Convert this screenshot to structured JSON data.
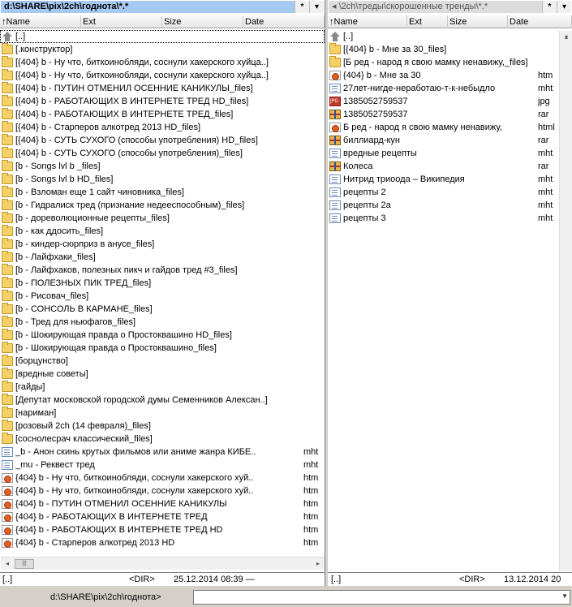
{
  "left": {
    "path": "d:\\SHARE\\pix\\2ch\\годнота\\*.*",
    "star": "*",
    "drop": "▾",
    "cols": {
      "name": "↑Name",
      "ext": "Ext",
      "size": "Size",
      "date": "Date"
    },
    "rows": [
      {
        "icon": "up",
        "name": "[..]",
        "ext": "",
        "selected": true
      },
      {
        "icon": "folder",
        "name": "[.конструктор]",
        "ext": ""
      },
      {
        "icon": "folder",
        "name": "[{404}  b - Ну что, биткоинобляди, соснули хакерского хуйца..]",
        "ext": ""
      },
      {
        "icon": "folder",
        "name": "[{404}  b - Ну что, биткоинобляди, соснули хакерского хуйца..]",
        "ext": ""
      },
      {
        "icon": "folder",
        "name": "[{404}  b - ПУТИН ОТМЕНИЛ ОСЕННИЕ КАНИКУЛЫ_files]",
        "ext": ""
      },
      {
        "icon": "folder",
        "name": "[{404}  b - РАБОТАЮЩИХ В ИНТЕРНЕТЕ ТРЕД HD_files]",
        "ext": ""
      },
      {
        "icon": "folder",
        "name": "[{404}  b - РАБОТАЮЩИХ В ИНТЕРНЕТЕ ТРЕД_files]",
        "ext": ""
      },
      {
        "icon": "folder",
        "name": "[{404}  b - Старперов алкотред 2013 HD_files]",
        "ext": ""
      },
      {
        "icon": "folder",
        "name": "[{404}  b - СУТЬ СУХОГО (способы употребления) HD_files]",
        "ext": ""
      },
      {
        "icon": "folder",
        "name": "[{404}  b - СУТЬ СУХОГО (способы употребления)_files]",
        "ext": ""
      },
      {
        "icon": "folder",
        "name": "[b - Songs lvl  b _files]",
        "ext": ""
      },
      {
        "icon": "folder",
        "name": "[b - Songs lvl  b HD_files]",
        "ext": ""
      },
      {
        "icon": "folder",
        "name": "[b - Взломан еще 1 сайт чиновника_files]",
        "ext": ""
      },
      {
        "icon": "folder",
        "name": "[b - Гидралиск тред (признание недееспособным)_files]",
        "ext": ""
      },
      {
        "icon": "folder",
        "name": "[b - дореволюционные рецепты_files]",
        "ext": ""
      },
      {
        "icon": "folder",
        "name": "[b - как ддосить_files]",
        "ext": ""
      },
      {
        "icon": "folder",
        "name": "[b - киндер-сюрприз в анусе_files]",
        "ext": ""
      },
      {
        "icon": "folder",
        "name": "[b - Лайфхаки_files]",
        "ext": ""
      },
      {
        "icon": "folder",
        "name": "[b - Лайфхаков, полезных пикч и гайдов тред #3_files]",
        "ext": ""
      },
      {
        "icon": "folder",
        "name": "[b - ПОЛЕЗНЫХ ПИК ТРЕД_files]",
        "ext": ""
      },
      {
        "icon": "folder",
        "name": "[b - Рисовач_files]",
        "ext": ""
      },
      {
        "icon": "folder",
        "name": "[b - СОНСОЛЬ В КАРМАНЕ_files]",
        "ext": ""
      },
      {
        "icon": "folder",
        "name": "[b - Тред для ньюфагов_files]",
        "ext": ""
      },
      {
        "icon": "folder",
        "name": "[b - Шокирующая правда о Простоквашино HD_files]",
        "ext": ""
      },
      {
        "icon": "folder",
        "name": "[b - Шокирующая правда о Простоквашино_files]",
        "ext": ""
      },
      {
        "icon": "folder",
        "name": "[борцунство]",
        "ext": ""
      },
      {
        "icon": "folder",
        "name": "[вредные советы]",
        "ext": ""
      },
      {
        "icon": "folder",
        "name": "[гайды]",
        "ext": ""
      },
      {
        "icon": "folder",
        "name": "[Депутат московской городской думы Семенников Алексан..]",
        "ext": ""
      },
      {
        "icon": "folder",
        "name": "[нариман]",
        "ext": ""
      },
      {
        "icon": "folder",
        "name": "[розовый 2ch (14 февраля)_files]",
        "ext": ""
      },
      {
        "icon": "folder",
        "name": "[соснолесрач классический_files]",
        "ext": ""
      },
      {
        "icon": "mht",
        "name": "_b - Анон скинь крутых фильмов или аниме жанра КИБЕ..",
        "ext": "mht"
      },
      {
        "icon": "mht",
        "name": "_mu - Реквест тред",
        "ext": "mht"
      },
      {
        "icon": "htm",
        "name": "{404}  b - Ну что, биткоинобляди, соснули хакерского хуй..",
        "ext": "htm"
      },
      {
        "icon": "htm",
        "name": "{404}  b - Ну что, биткоинобляди, соснули хакерского хуй..",
        "ext": "htm"
      },
      {
        "icon": "htm",
        "name": "{404}  b - ПУТИН ОТМЕНИЛ ОСЕННИЕ КАНИКУЛЫ",
        "ext": "htm"
      },
      {
        "icon": "htm",
        "name": "{404}  b - РАБОТАЮЩИХ В ИНТЕРНЕТЕ ТРЕД",
        "ext": "htm"
      },
      {
        "icon": "htm",
        "name": "{404}  b - РАБОТАЮЩИХ В ИНТЕРНЕТЕ ТРЕД HD",
        "ext": "htm"
      },
      {
        "icon": "htm",
        "name": "{404}  b - Старперов алкотред 2013 HD",
        "ext": "htm"
      }
    ],
    "status": {
      "name": "[..]",
      "size": "<DIR>",
      "date": "25.12.2014 08:39 —"
    },
    "hscroll_thumb": "|||"
  },
  "right": {
    "path": "◂ \\2ch\\треды\\скорошенные тренды\\*.*",
    "star": "*",
    "drop": "▾",
    "cols": {
      "name": "↑Name",
      "ext": "Ext",
      "size": "Size",
      "date": "Date"
    },
    "rows": [
      {
        "icon": "up",
        "name": "[..]",
        "ext": ""
      },
      {
        "icon": "folder",
        "name": "[{404}  b - Мне за 30_files]",
        "ext": ""
      },
      {
        "icon": "folder",
        "name": "[Б ред - народ я свою мамку ненавижу,_files]",
        "ext": ""
      },
      {
        "icon": "htm",
        "name": "{404}  b - Мне за 30",
        "ext": "htm"
      },
      {
        "icon": "mht",
        "name": "27лет-нигде-неработаю-т-к-небыдло",
        "ext": "mht"
      },
      {
        "icon": "jpg",
        "name": "1385052759537",
        "ext": "jpg"
      },
      {
        "icon": "rar",
        "name": "1385052759537",
        "ext": "rar"
      },
      {
        "icon": "htm",
        "name": "Б ред - народ я свою мамку ненавижу,",
        "ext": "html"
      },
      {
        "icon": "rar",
        "name": "биллиард-кун",
        "ext": "rar"
      },
      {
        "icon": "mht",
        "name": "вредные рецепты",
        "ext": "mht"
      },
      {
        "icon": "rar",
        "name": "Колеса",
        "ext": "rar"
      },
      {
        "icon": "mht",
        "name": "Нитрид триоода – Википедия",
        "ext": "mht"
      },
      {
        "icon": "mht",
        "name": "рецепты 2",
        "ext": "mht"
      },
      {
        "icon": "mht",
        "name": "рецепты 2а",
        "ext": "mht"
      },
      {
        "icon": "mht",
        "name": "рецепты 3",
        "ext": "mht"
      }
    ],
    "status": {
      "name": "[..]",
      "size": "<DIR>",
      "date": "13.12.2014 20"
    }
  },
  "cmdline": {
    "path": "d:\\SHARE\\pix\\2ch\\годнота>",
    "value": ""
  }
}
